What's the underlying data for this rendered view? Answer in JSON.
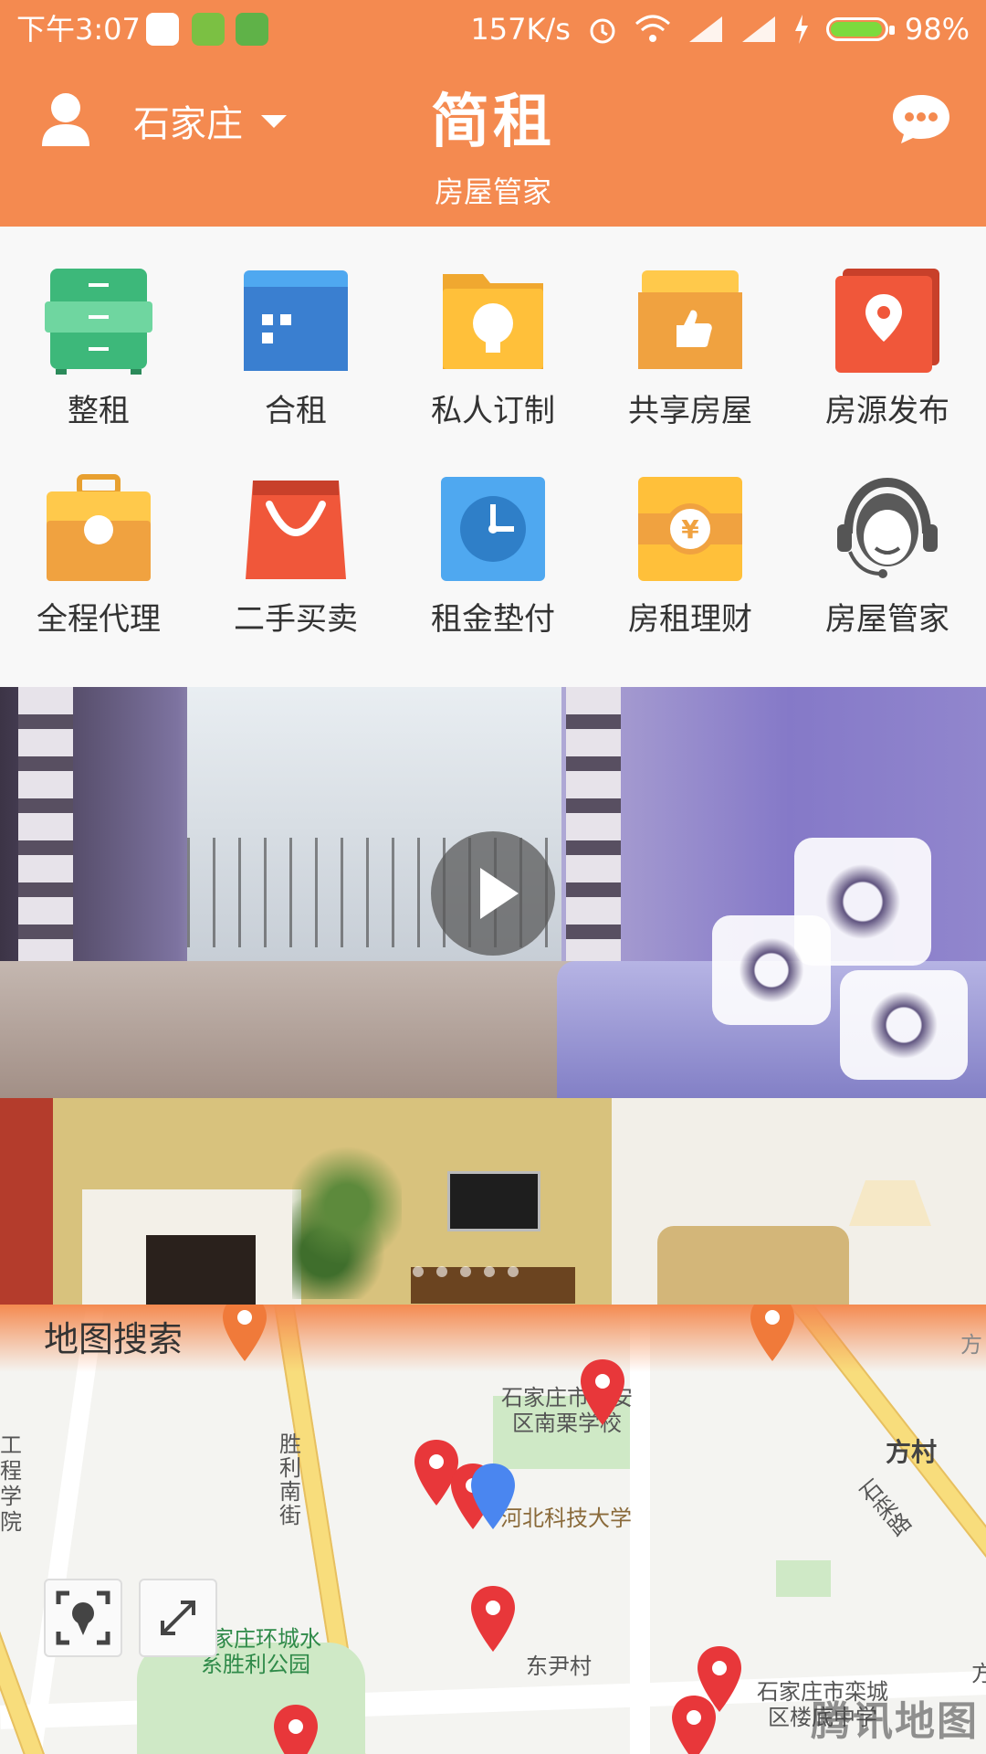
{
  "status_bar": {
    "time": "下午3:07",
    "speed": "157K/s",
    "battery": "98%"
  },
  "header": {
    "city": "石家庄",
    "brand": "简租",
    "subtitle": "房屋管家"
  },
  "grid": [
    {
      "label": "整租",
      "icon": "cabinet-icon"
    },
    {
      "label": "合租",
      "icon": "building-icon"
    },
    {
      "label": "私人订制",
      "icon": "lightbulb-folder-icon"
    },
    {
      "label": "共享房屋",
      "icon": "thumbs-up-box-icon"
    },
    {
      "label": "房源发布",
      "icon": "location-pin-icon"
    },
    {
      "label": "全程代理",
      "icon": "briefcase-icon"
    },
    {
      "label": "二手买卖",
      "icon": "shopping-bag-icon"
    },
    {
      "label": "租金垫付",
      "icon": "clock-icon"
    },
    {
      "label": "房租理财",
      "icon": "yuan-coin-icon"
    },
    {
      "label": "房屋管家",
      "icon": "headset-agent-icon"
    }
  ],
  "map": {
    "title": "地图搜索",
    "labels": {
      "road1": "胜利南街",
      "school": "石家庄市长安区南栗学校",
      "university": "河北科技大学",
      "village": "方村",
      "road2": "石栾路",
      "park": "石家庄环城水系胜利公园",
      "village2": "东尹村",
      "school2": "石家庄市栾城区楼底中学",
      "left": "工程学院",
      "edge1": "方",
      "edge2": "方"
    },
    "watermark": "腾讯地图"
  },
  "colors": {
    "accent": "#F48A50",
    "pin": "#E8373A",
    "me": "#4A86F0"
  }
}
